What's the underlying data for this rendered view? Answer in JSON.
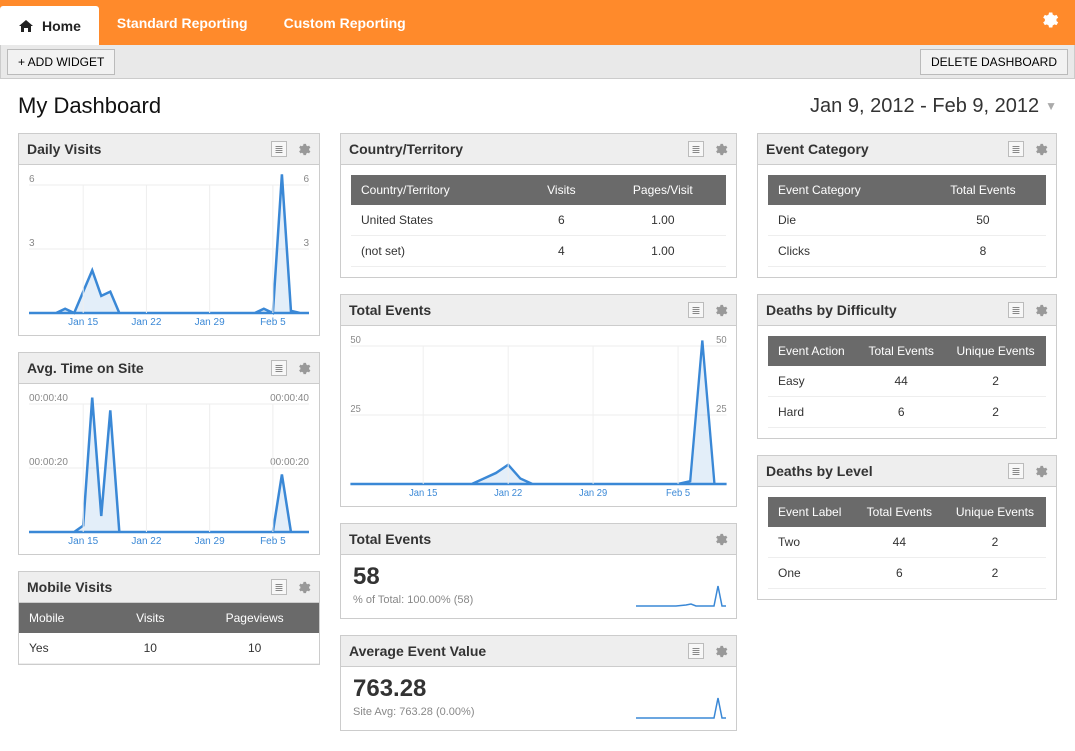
{
  "topnav": {
    "tabs": [
      "Home",
      "Standard Reporting",
      "Custom Reporting"
    ]
  },
  "toolbar": {
    "add_widget": "+ ADD WIDGET",
    "delete_dashboard": "DELETE DASHBOARD"
  },
  "page_title": "My Dashboard",
  "date_range": "Jan 9, 2012 - Feb 9, 2012",
  "widgets": {
    "daily_visits": {
      "title": "Daily Visits"
    },
    "avg_time": {
      "title": "Avg. Time on Site"
    },
    "mobile_visits": {
      "title": "Mobile Visits",
      "cols": [
        "Mobile",
        "Visits",
        "Pageviews"
      ],
      "rows": [
        [
          "Yes",
          "10",
          "10"
        ]
      ]
    },
    "country": {
      "title": "Country/Territory",
      "cols": [
        "Country/Territory",
        "Visits",
        "Pages/Visit"
      ],
      "rows": [
        [
          "United States",
          "6",
          "1.00"
        ],
        [
          "(not set)",
          "4",
          "1.00"
        ]
      ]
    },
    "total_events_chart": {
      "title": "Total Events"
    },
    "total_events_metric": {
      "title": "Total Events",
      "value": "58",
      "sub": "% of Total: 100.00% (58)"
    },
    "avg_event_value": {
      "title": "Average Event Value",
      "value": "763.28",
      "sub": "Site Avg: 763.28 (0.00%)"
    },
    "event_category": {
      "title": "Event Category",
      "cols": [
        "Event Category",
        "Total Events"
      ],
      "rows": [
        [
          "Die",
          "50"
        ],
        [
          "Clicks",
          "8"
        ]
      ]
    },
    "deaths_difficulty": {
      "title": "Deaths by Difficulty",
      "cols": [
        "Event Action",
        "Total Events",
        "Unique Events"
      ],
      "rows": [
        [
          "Easy",
          "44",
          "2"
        ],
        [
          "Hard",
          "6",
          "2"
        ]
      ]
    },
    "deaths_level": {
      "title": "Deaths by Level",
      "cols": [
        "Event Label",
        "Total Events",
        "Unique Events"
      ],
      "rows": [
        [
          "Two",
          "44",
          "2"
        ],
        [
          "One",
          "6",
          "2"
        ]
      ]
    }
  },
  "chart_data": [
    {
      "type": "line",
      "widget": "daily_visits",
      "xticks": [
        "Jan 15",
        "Jan 22",
        "Jan 29",
        "Feb 5"
      ],
      "ylim": [
        0,
        6
      ],
      "yticks": [
        3,
        6
      ],
      "values": [
        0,
        0,
        0,
        0,
        0.2,
        0,
        1,
        2,
        0.8,
        1,
        0,
        0,
        0,
        0,
        0,
        0,
        0,
        0,
        0,
        0,
        0,
        0,
        0,
        0,
        0,
        0,
        0.2,
        0,
        6.5,
        0.1,
        0,
        0
      ]
    },
    {
      "type": "line",
      "widget": "avg_time",
      "xticks": [
        "Jan 15",
        "Jan 22",
        "Jan 29",
        "Feb 5"
      ],
      "ylabels": [
        "00:00:20",
        "00:00:40"
      ],
      "ylim": [
        0,
        40
      ],
      "values": [
        0,
        0,
        0,
        0,
        0,
        0,
        2,
        42,
        5,
        38,
        0,
        0,
        0,
        0,
        0,
        0,
        0,
        0,
        0,
        0,
        0,
        0,
        0,
        0,
        0,
        0,
        0,
        0,
        18,
        0,
        0,
        0
      ]
    },
    {
      "type": "line",
      "widget": "total_events_chart",
      "xticks": [
        "Jan 15",
        "Jan 22",
        "Jan 29",
        "Feb 5"
      ],
      "ylim": [
        0,
        50
      ],
      "yticks": [
        25,
        50
      ],
      "values": [
        0,
        0,
        0,
        0,
        0,
        0,
        0,
        0,
        0,
        0,
        0,
        2,
        4,
        7,
        2,
        0,
        0,
        0,
        0,
        0,
        0,
        0,
        0,
        0,
        0,
        0,
        0,
        0,
        1,
        52,
        0,
        0
      ]
    }
  ]
}
